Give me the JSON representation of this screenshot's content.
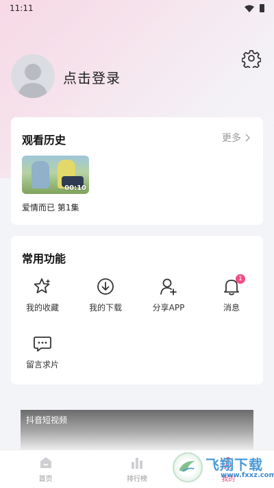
{
  "status_bar": {
    "time": "11:11"
  },
  "profile": {
    "login_text": "点击登录"
  },
  "history": {
    "title": "观看历史",
    "more_label": "更多",
    "item": {
      "duration": "00:10",
      "title": "爱情而已 第1集"
    }
  },
  "features": {
    "title": "常用功能",
    "items": [
      {
        "label": "我的收藏",
        "icon": "star-icon"
      },
      {
        "label": "我的下载",
        "icon": "download-icon"
      },
      {
        "label": "分享APP",
        "icon": "share-user-icon"
      },
      {
        "label": "消息",
        "icon": "bell-icon",
        "badge": "1"
      },
      {
        "label": "留言求片",
        "icon": "message-icon"
      }
    ]
  },
  "banner": {
    "text": "抖音短视频"
  },
  "tabbar": {
    "tabs": [
      {
        "label": "首页",
        "icon": "home-icon"
      },
      {
        "label": "排行榜",
        "icon": "ranking-icon"
      },
      {
        "label": "我的",
        "icon": "profile-icon",
        "active": true
      }
    ]
  },
  "watermark": {
    "line1": "飞翔下载",
    "line2": "www.fxxz.com"
  },
  "colors": {
    "accent": "#e24f7e",
    "badge": "#ef4f83",
    "background": "#f3f4f8"
  }
}
